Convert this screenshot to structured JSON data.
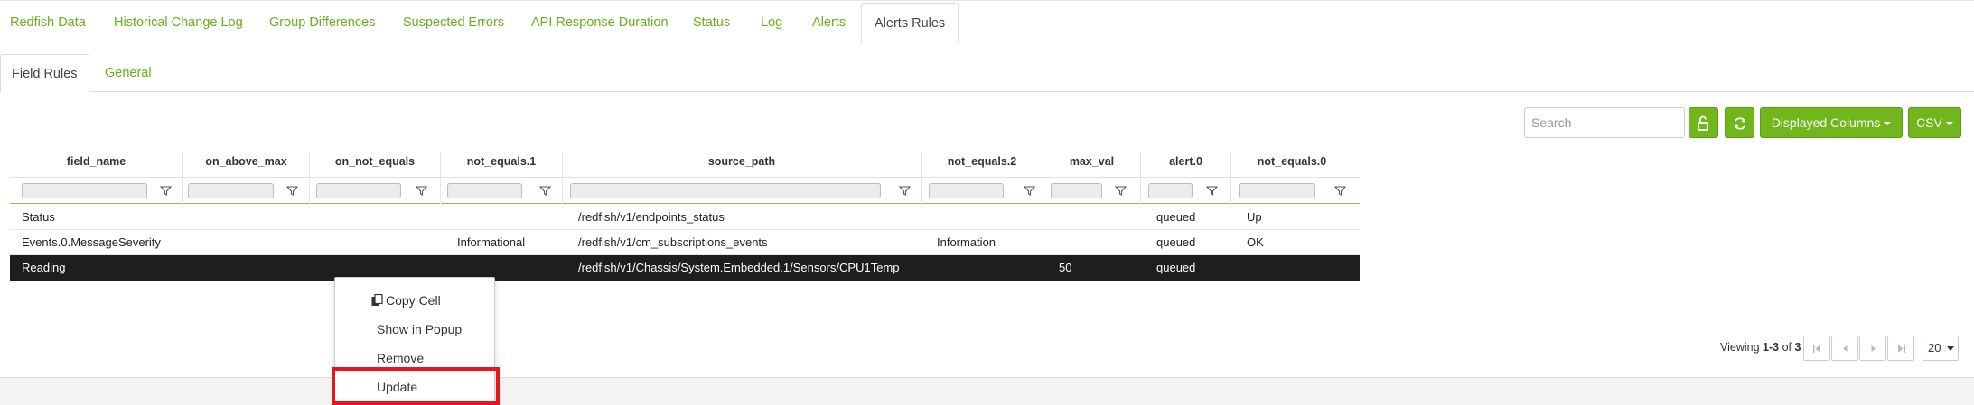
{
  "top_tabs": [
    "Redfish Data",
    "Historical Change Log",
    "Group Differences",
    "Suspected Errors",
    "API Response Duration",
    "Status",
    "Log",
    "Alerts",
    "Alerts Rules"
  ],
  "active_top_tab": "Alerts Rules",
  "sub_tabs": [
    "Field Rules",
    "General"
  ],
  "active_sub_tab": "Field Rules",
  "toolbar": {
    "search_placeholder": "Search",
    "displayed_columns_label": "Displayed Columns",
    "csv_label": "CSV",
    "unlock_icon": "unlock-icon",
    "refresh_icon": "refresh-icon"
  },
  "table": {
    "columns": [
      "field_name",
      "on_above_max",
      "on_not_equals",
      "not_equals.1",
      "source_path",
      "not_equals.2",
      "max_val",
      "alert.0",
      "not_equals.0"
    ],
    "rows": [
      [
        "Status",
        "",
        "",
        "",
        "/redfish/v1/endpoints_status",
        "",
        "",
        "queued",
        "Up"
      ],
      [
        "Events.0.MessageSeverity",
        "",
        "",
        "Informational",
        "/redfish/v1/cm_subscriptions_events",
        "Information",
        "",
        "queued",
        "OK"
      ],
      [
        "Reading",
        "",
        "",
        "",
        "/redfish/v1/Chassis/System.Embedded.1/Sensors/CPU1Temp",
        "",
        "50",
        "queued",
        ""
      ]
    ],
    "selected_row": 2
  },
  "context_menu": {
    "items": [
      "Copy Cell",
      "Show in Popup",
      "Remove",
      "Update"
    ],
    "highlighted_item": "Update"
  },
  "pager": {
    "viewing_prefix": "Viewing ",
    "range": "1-3",
    "of_label": " of ",
    "total": "3",
    "page_size": "20"
  },
  "colors": {
    "accent": "#71b61c",
    "link": "#6aad1e",
    "selected_row": "#1e1e1e",
    "highlight_box": "#e8141e"
  }
}
